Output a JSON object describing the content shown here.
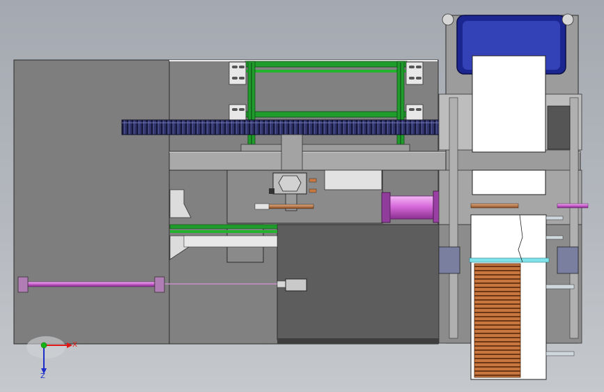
{
  "viewport": {
    "background_top": "#a4a9b1",
    "background_bottom": "#c5c8cc"
  },
  "colors": {
    "plate_gray": "#7d7d7d",
    "plate_dark": "#5a5a5a",
    "plate_light": "#9a9a9a",
    "frame_green": "#21a32d",
    "rack_navy": "#2e3168",
    "cylinder_magenta": "#d86adb",
    "cylinder_end": "#8f3c9a",
    "hopper_blue": "#1c2690",
    "coil_copper": "#c87741",
    "bar_cyan": "#7fe3ea",
    "white": "#ffffff",
    "edge_black": "#1a1a1a"
  },
  "triad": {
    "x_label": "X",
    "z_label": "Z",
    "x_color": "#e01818",
    "z_color": "#1c2cc8",
    "origin_color": "#16b216"
  }
}
